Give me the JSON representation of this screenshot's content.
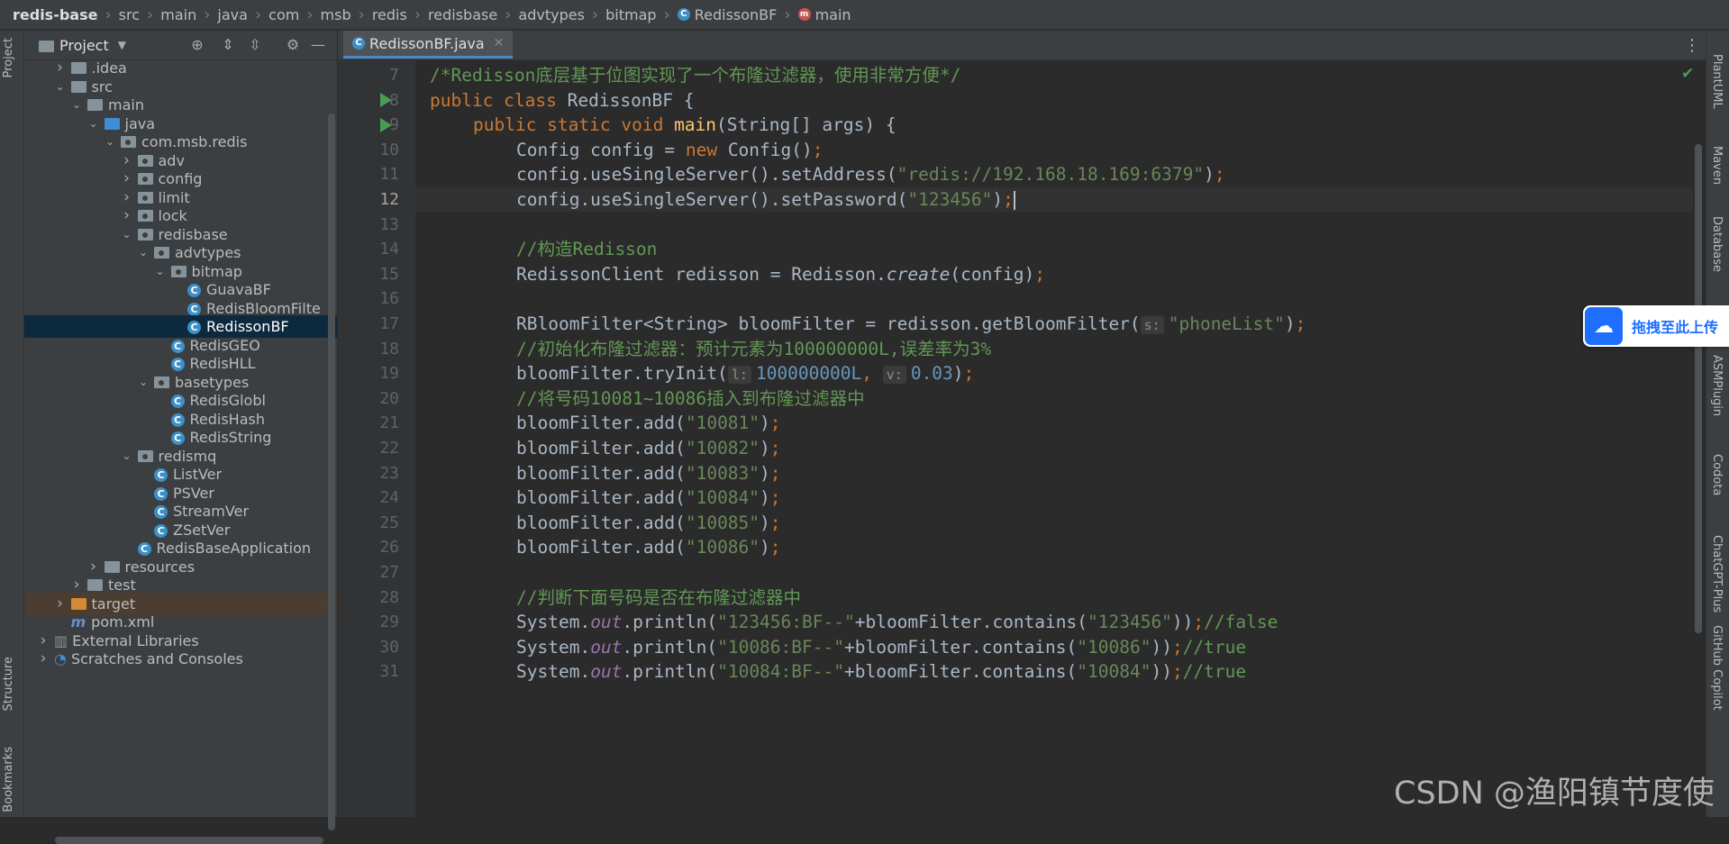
{
  "breadcrumb": [
    "redis-base",
    "src",
    "main",
    "java",
    "com",
    "msb",
    "redis",
    "redisbase",
    "advtypes",
    "bitmap",
    "RedissonBF",
    "main"
  ],
  "left_strip": {
    "project": "Project",
    "structure": "Structure",
    "bookmarks": "Bookmarks"
  },
  "project_panel": {
    "title": "Project"
  },
  "tree": [
    {
      "label": ".idea",
      "depth": 1,
      "kind": "folder",
      "arrow": "right"
    },
    {
      "label": "src",
      "depth": 1,
      "kind": "folder",
      "arrow": "down"
    },
    {
      "label": "main",
      "depth": 2,
      "kind": "folder",
      "arrow": "down"
    },
    {
      "label": "java",
      "depth": 3,
      "kind": "folder-blue",
      "arrow": "down"
    },
    {
      "label": "com.msb.redis",
      "depth": 4,
      "kind": "package",
      "arrow": "down"
    },
    {
      "label": "adv",
      "depth": 5,
      "kind": "package",
      "arrow": "right"
    },
    {
      "label": "config",
      "depth": 5,
      "kind": "package",
      "arrow": "right"
    },
    {
      "label": "limit",
      "depth": 5,
      "kind": "package",
      "arrow": "right"
    },
    {
      "label": "lock",
      "depth": 5,
      "kind": "package",
      "arrow": "right"
    },
    {
      "label": "redisbase",
      "depth": 5,
      "kind": "package",
      "arrow": "down"
    },
    {
      "label": "advtypes",
      "depth": 6,
      "kind": "package",
      "arrow": "down"
    },
    {
      "label": "bitmap",
      "depth": 7,
      "kind": "package",
      "arrow": "down"
    },
    {
      "label": "GuavaBF",
      "depth": 8,
      "kind": "class",
      "arrow": ""
    },
    {
      "label": "RedisBloomFilte",
      "depth": 8,
      "kind": "class",
      "arrow": ""
    },
    {
      "label": "RedissonBF",
      "depth": 8,
      "kind": "class",
      "arrow": "",
      "selected": true
    },
    {
      "label": "RedisGEO",
      "depth": 7,
      "kind": "class",
      "arrow": ""
    },
    {
      "label": "RedisHLL",
      "depth": 7,
      "kind": "class",
      "arrow": ""
    },
    {
      "label": "basetypes",
      "depth": 6,
      "kind": "package",
      "arrow": "down"
    },
    {
      "label": "RedisGlobl",
      "depth": 7,
      "kind": "class",
      "arrow": ""
    },
    {
      "label": "RedisHash",
      "depth": 7,
      "kind": "class",
      "arrow": ""
    },
    {
      "label": "RedisString",
      "depth": 7,
      "kind": "class",
      "arrow": ""
    },
    {
      "label": "redismq",
      "depth": 5,
      "kind": "package",
      "arrow": "down"
    },
    {
      "label": "ListVer",
      "depth": 6,
      "kind": "class",
      "arrow": ""
    },
    {
      "label": "PSVer",
      "depth": 6,
      "kind": "class",
      "arrow": ""
    },
    {
      "label": "StreamVer",
      "depth": 6,
      "kind": "class",
      "arrow": ""
    },
    {
      "label": "ZSetVer",
      "depth": 6,
      "kind": "class",
      "arrow": ""
    },
    {
      "label": "RedisBaseApplication",
      "depth": 5,
      "kind": "class",
      "arrow": ""
    },
    {
      "label": "resources",
      "depth": 3,
      "kind": "folder",
      "arrow": "right"
    },
    {
      "label": "test",
      "depth": 2,
      "kind": "folder",
      "arrow": "right"
    },
    {
      "label": "target",
      "depth": 1,
      "kind": "folder-orange",
      "arrow": "right",
      "highlight": true
    },
    {
      "label": "pom.xml",
      "depth": 1,
      "kind": "maven",
      "arrow": ""
    },
    {
      "label": "External Libraries",
      "depth": 0,
      "kind": "libs",
      "arrow": "right"
    },
    {
      "label": "Scratches and Consoles",
      "depth": 0,
      "kind": "scratch",
      "arrow": "right"
    }
  ],
  "editor": {
    "tab": "RedissonBF.java",
    "current_line": 12,
    "lines": [
      {
        "n": 7,
        "indent": 0,
        "segs": [
          [
            "dcm",
            "/*Redisson底层基于位图实现了一个布隆过滤器，使用非常方便*/"
          ]
        ]
      },
      {
        "n": 8,
        "indent": 0,
        "run": true,
        "segs": [
          [
            "kw",
            "public class "
          ],
          [
            "id",
            "RedissonBF {"
          ]
        ]
      },
      {
        "n": 9,
        "indent": 1,
        "run": true,
        "segs": [
          [
            "kw",
            "public static void "
          ],
          [
            "fn",
            "main"
          ],
          [
            "id",
            "(String[] args) {"
          ]
        ]
      },
      {
        "n": 10,
        "indent": 2,
        "segs": [
          [
            "id",
            "Config config = "
          ],
          [
            "kw",
            "new "
          ],
          [
            "id",
            "Config()"
          ],
          [
            "kw",
            ";"
          ]
        ]
      },
      {
        "n": 11,
        "indent": 2,
        "segs": [
          [
            "id",
            "config.useSingleServer().setAddress("
          ],
          [
            "str",
            "\"redis://192.168.18.169:6379\""
          ],
          [
            "id",
            ")"
          ],
          [
            "kw",
            ";"
          ]
        ]
      },
      {
        "n": 12,
        "indent": 2,
        "segs": [
          [
            "id",
            "config.useSingleServer().setPassword("
          ],
          [
            "str",
            "\"123456\""
          ],
          [
            "id",
            ")"
          ],
          [
            "kw",
            ";"
          ],
          [
            "caret",
            ""
          ]
        ]
      },
      {
        "n": 13,
        "indent": 0,
        "segs": []
      },
      {
        "n": 14,
        "indent": 2,
        "segs": [
          [
            "dcm",
            "//构造Redisson"
          ]
        ]
      },
      {
        "n": 15,
        "indent": 2,
        "segs": [
          [
            "id",
            "RedissonClient redisson = Redisson."
          ],
          [
            "idit",
            "create"
          ],
          [
            "id",
            "(config)"
          ],
          [
            "kw",
            ";"
          ]
        ]
      },
      {
        "n": 16,
        "indent": 0,
        "segs": []
      },
      {
        "n": 17,
        "indent": 2,
        "segs": [
          [
            "id",
            "RBloomFilter<String> bloomFilter = redisson.getBloomFilter("
          ],
          [
            "hint",
            "s:"
          ],
          [
            "str",
            "\"phoneList\""
          ],
          [
            "id",
            ")"
          ],
          [
            "kw",
            ";"
          ]
        ]
      },
      {
        "n": 18,
        "indent": 2,
        "segs": [
          [
            "dcm",
            "//初始化布隆过滤器：预计元素为100000000L,误差率为3%"
          ]
        ]
      },
      {
        "n": 19,
        "indent": 2,
        "segs": [
          [
            "id",
            "bloomFilter.tryInit("
          ],
          [
            "hint",
            "l:"
          ],
          [
            "num",
            "100000000L"
          ],
          [
            "kw",
            ", "
          ],
          [
            "hint",
            "v:"
          ],
          [
            "num",
            "0.03"
          ],
          [
            "id",
            ")"
          ],
          [
            "kw",
            ";"
          ]
        ]
      },
      {
        "n": 20,
        "indent": 2,
        "segs": [
          [
            "dcm",
            "//将号码10081~10086插入到布隆过滤器中"
          ]
        ]
      },
      {
        "n": 21,
        "indent": 2,
        "segs": [
          [
            "id",
            "bloomFilter.add("
          ],
          [
            "str",
            "\"10081\""
          ],
          [
            "id",
            ")"
          ],
          [
            "kw",
            ";"
          ]
        ]
      },
      {
        "n": 22,
        "indent": 2,
        "segs": [
          [
            "id",
            "bloomFilter.add("
          ],
          [
            "str",
            "\"10082\""
          ],
          [
            "id",
            ")"
          ],
          [
            "kw",
            ";"
          ]
        ]
      },
      {
        "n": 23,
        "indent": 2,
        "segs": [
          [
            "id",
            "bloomFilter.add("
          ],
          [
            "str",
            "\"10083\""
          ],
          [
            "id",
            ")"
          ],
          [
            "kw",
            ";"
          ]
        ]
      },
      {
        "n": 24,
        "indent": 2,
        "segs": [
          [
            "id",
            "bloomFilter.add("
          ],
          [
            "str",
            "\"10084\""
          ],
          [
            "id",
            ")"
          ],
          [
            "kw",
            ";"
          ]
        ]
      },
      {
        "n": 25,
        "indent": 2,
        "segs": [
          [
            "id",
            "bloomFilter.add("
          ],
          [
            "str",
            "\"10085\""
          ],
          [
            "id",
            ")"
          ],
          [
            "kw",
            ";"
          ]
        ]
      },
      {
        "n": 26,
        "indent": 2,
        "segs": [
          [
            "id",
            "bloomFilter.add("
          ],
          [
            "str",
            "\"10086\""
          ],
          [
            "id",
            ")"
          ],
          [
            "kw",
            ";"
          ]
        ]
      },
      {
        "n": 27,
        "indent": 0,
        "segs": []
      },
      {
        "n": 28,
        "indent": 2,
        "segs": [
          [
            "dcm",
            "//判断下面号码是否在布隆过滤器中"
          ]
        ]
      },
      {
        "n": 29,
        "indent": 2,
        "segs": [
          [
            "id",
            "System."
          ],
          [
            "st",
            "out"
          ],
          [
            "id",
            ".println("
          ],
          [
            "str",
            "\"123456:BF--\""
          ],
          [
            "id",
            "+bloomFilter.contains("
          ],
          [
            "str",
            "\"123456\""
          ],
          [
            "id",
            "))"
          ],
          [
            "kw",
            ";"
          ],
          [
            "dcm",
            "//false"
          ]
        ]
      },
      {
        "n": 30,
        "indent": 2,
        "segs": [
          [
            "id",
            "System."
          ],
          [
            "st",
            "out"
          ],
          [
            "id",
            ".println("
          ],
          [
            "str",
            "\"10086:BF--\""
          ],
          [
            "id",
            "+bloomFilter.contains("
          ],
          [
            "str",
            "\"10086\""
          ],
          [
            "id",
            "))"
          ],
          [
            "kw",
            ";"
          ],
          [
            "dcm",
            "//true"
          ]
        ]
      },
      {
        "n": 31,
        "indent": 2,
        "segs": [
          [
            "id",
            "System."
          ],
          [
            "st",
            "out"
          ],
          [
            "id",
            ".println("
          ],
          [
            "str",
            "\"10084:BF--\""
          ],
          [
            "id",
            "+bloomFilter.contains("
          ],
          [
            "str",
            "\"10084\""
          ],
          [
            "id",
            "))"
          ],
          [
            "kw",
            ";"
          ],
          [
            "dcm",
            "//true"
          ]
        ]
      }
    ]
  },
  "right_strip": [
    "PlantUML",
    "Maven",
    "Database",
    "ASMPlugin",
    "Codota",
    "ChatGPT-Plus",
    "GitHub Copilot"
  ],
  "upload_widget": {
    "label": "拖拽至此上传"
  },
  "watermark": "CSDN @渔阳镇节度使"
}
